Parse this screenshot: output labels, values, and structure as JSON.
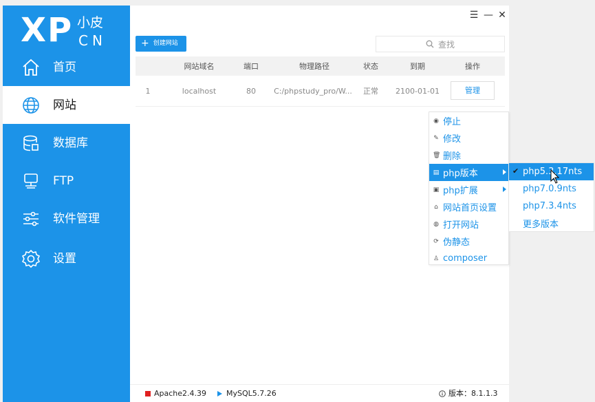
{
  "logo": {
    "primary": "XP",
    "sub_top": "小皮",
    "sub_bottom": "CN"
  },
  "sidebar": {
    "items": [
      {
        "label": "首页",
        "icon": "home-icon",
        "active": false
      },
      {
        "label": "网站",
        "icon": "globe-icon",
        "active": true
      },
      {
        "label": "数据库",
        "icon": "database-icon",
        "active": false
      },
      {
        "label": "FTP",
        "icon": "ftp-icon",
        "active": false
      },
      {
        "label": "软件管理",
        "icon": "sliders-icon",
        "active": false
      },
      {
        "label": "设置",
        "icon": "settings-icon",
        "active": false
      }
    ]
  },
  "window_controls": {
    "menu": "☰",
    "minimize": "—",
    "close": "✕"
  },
  "toolbar": {
    "create_label": "创建网站",
    "search_placeholder": "查找"
  },
  "table": {
    "headers": [
      "网站域名",
      "端口",
      "物理路径",
      "状态",
      "到期",
      "操作"
    ],
    "rows": [
      {
        "id": "1",
        "domain": "localhost",
        "port": "80",
        "path": "C:/phpstudy_pro/W...",
        "status": "正常",
        "expiry": "2100-01-01",
        "action": "管理"
      }
    ]
  },
  "context_menu": {
    "items": [
      {
        "label": "停止",
        "icon": "stop-icon",
        "glyph": "◉"
      },
      {
        "label": "修改",
        "icon": "pencil-icon",
        "glyph": "✎"
      },
      {
        "label": "删除",
        "icon": "trash-icon",
        "glyph": "🗑"
      },
      {
        "label": "php版本",
        "icon": "php-version-icon",
        "glyph": "▤",
        "submenu": true,
        "highlighted": true
      },
      {
        "label": "php扩展",
        "icon": "php-extension-icon",
        "glyph": "▣",
        "submenu": true
      },
      {
        "label": "网站首页设置",
        "icon": "home-settings-icon",
        "glyph": "⌂"
      },
      {
        "label": "打开网站",
        "icon": "open-site-icon",
        "glyph": "◍"
      },
      {
        "label": "伪静态",
        "icon": "rewrite-icon",
        "glyph": "⟳"
      },
      {
        "label": "composer",
        "icon": "composer-icon",
        "glyph": "♙"
      }
    ]
  },
  "php_submenu": {
    "items": [
      {
        "label": "php5.3.17nts",
        "checked": true,
        "highlighted": true
      },
      {
        "label": "php7.0.9nts",
        "checked": false
      },
      {
        "label": "php7.3.4nts",
        "checked": false
      },
      {
        "label": "更多版本",
        "checked": false
      }
    ]
  },
  "statusbar": {
    "apache": "Apache2.4.39",
    "mysql": "MySQL5.7.26",
    "version": "版本：8.1.1.3"
  },
  "colors": {
    "accent": "#1c93e8",
    "stopped": "#e02020"
  }
}
